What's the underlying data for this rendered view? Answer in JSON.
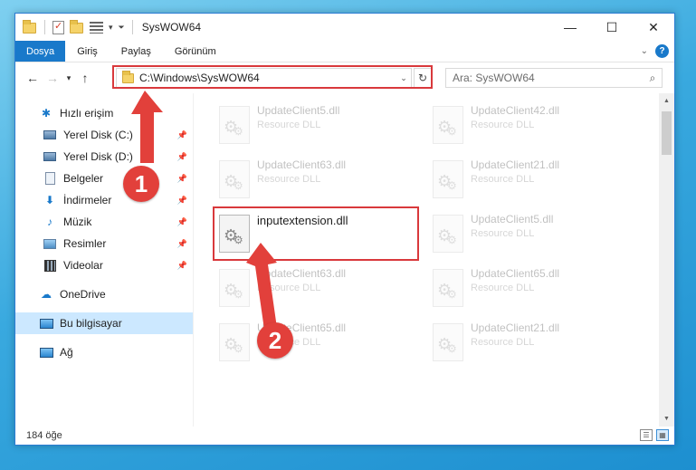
{
  "window": {
    "title": "SysWOW64",
    "minimize": "—",
    "maximize": "☐",
    "close": "✕"
  },
  "ribbon": {
    "tabs": [
      "Dosya",
      "Giriş",
      "Paylaş",
      "Görünüm"
    ],
    "help": "?"
  },
  "address": {
    "path": "C:\\Windows\\SysWOW64",
    "refresh": "↻"
  },
  "search": {
    "placeholder": "Ara: SysWOW64",
    "icon": "⌕"
  },
  "sidebar": {
    "quick_access": "Hızlı erişim",
    "items": [
      {
        "label": "Yerel Disk (C:)",
        "icon": "drive-icon"
      },
      {
        "label": "Yerel Disk (D:)",
        "icon": "drive-icon"
      },
      {
        "label": "Belgeler",
        "icon": "document-icon"
      },
      {
        "label": "İndirmeler",
        "icon": "download-icon"
      },
      {
        "label": "Müzik",
        "icon": "music-icon"
      },
      {
        "label": "Resimler",
        "icon": "pictures-icon"
      },
      {
        "label": "Videolar",
        "icon": "video-icon"
      }
    ],
    "onedrive": "OneDrive",
    "this_pc": "Bu bilgisayar",
    "network": "Ağ"
  },
  "files": [
    {
      "name": "UpdateClient5.dll",
      "type": "Resource DLL",
      "faded": true
    },
    {
      "name": "UpdateClient42.dll",
      "type": "Resource DLL",
      "faded": true
    },
    {
      "name": "UpdateClient63.dll",
      "type": "Resource DLL",
      "faded": true
    },
    {
      "name": "UpdateClient21.dll",
      "type": "Resource DLL",
      "faded": true
    },
    {
      "name": "inputextension.dll",
      "type": "",
      "faded": false
    },
    {
      "name": "UpdateClient5.dll",
      "type": "Resource DLL",
      "faded": true
    },
    {
      "name": "UpdateClient63.dll",
      "type": "Resource DLL",
      "faded": true
    },
    {
      "name": "UpdateClient65.dll",
      "type": "Resource DLL",
      "faded": true
    },
    {
      "name": "UpdateClient65.dll",
      "type": "Resource DLL",
      "faded": true
    },
    {
      "name": "UpdateClient21.dll",
      "type": "Resource DLL",
      "faded": true
    }
  ],
  "status": {
    "count": "184 öğe"
  },
  "annotations": {
    "step1": "1",
    "step2": "2",
    "color": "#e2403b"
  }
}
